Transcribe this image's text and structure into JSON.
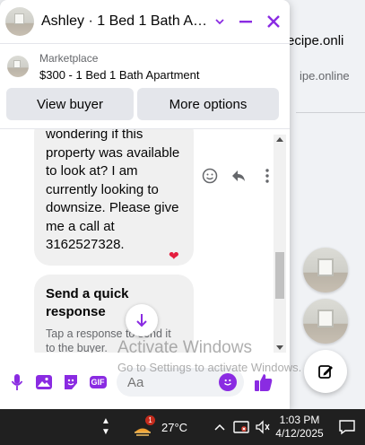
{
  "background": {
    "link1": "ecipe.onli",
    "link2": "ipe.online"
  },
  "chat": {
    "title": "Ashley · 1 Bed 1 Bath Apart…",
    "listing": {
      "kicker": "Marketplace",
      "name": "$300 - 1 Bed 1 Bath Apartment"
    },
    "actions": {
      "view_buyer": "View buyer",
      "more_options": "More options"
    },
    "message_text": "wondering if this property was available to look at? I am currently looking to downsize. Please give me a call at 3162527328.",
    "reaction": "❤",
    "quick_reply": {
      "title": "Send a quick response",
      "subtitle": "Tap a response to send it to the buyer."
    },
    "composer": {
      "placeholder": "Aa",
      "gif_label": "GIF"
    }
  },
  "watermark": {
    "title": "Activate Windows",
    "subtitle": "Go to Settings to activate Windows."
  },
  "taskbar": {
    "weather_badge": "1",
    "temperature": "27°C",
    "time": "1:03 PM",
    "date": "4/12/2025"
  },
  "colors": {
    "accent": "#8a2be2",
    "bubble": "#f0f0f0",
    "taskbar": "#202020"
  },
  "icons": [
    "minimize-icon",
    "close-icon",
    "chevron-down-icon",
    "emoji-icon",
    "reply-icon",
    "more-icon",
    "mic-icon",
    "photo-icon",
    "sticker-icon",
    "gif-icon",
    "like-icon",
    "compose-icon",
    "weather-icon",
    "chevron-up-icon",
    "network-icon",
    "volume-icon",
    "notification-icon"
  ]
}
